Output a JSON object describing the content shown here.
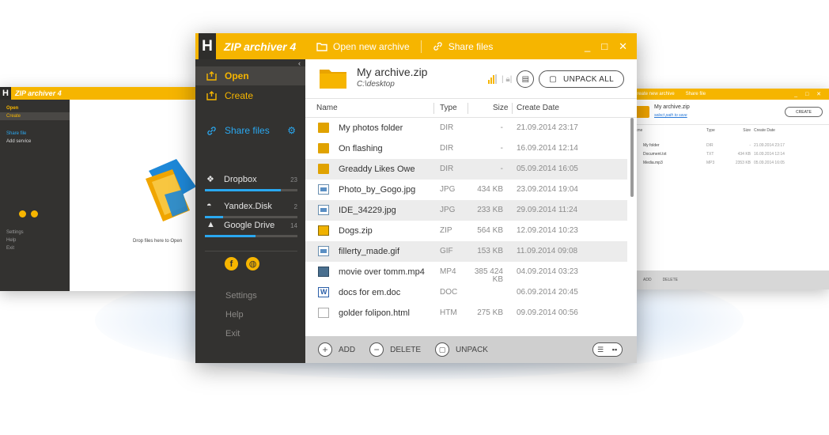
{
  "bg_left": {
    "title": "ZIP archiver 4",
    "menu": {
      "open": "Open",
      "create": "Create",
      "share": "Share file",
      "add_service": "Add service",
      "settings": "Settings",
      "help": "Help",
      "exit": "Exit"
    },
    "drop_text": "Drop files here to Open"
  },
  "bg_right": {
    "title_items": [
      "Create new archive",
      "Share file"
    ],
    "archive_name": "My archive.zip",
    "archive_link": "select path to save",
    "create_label": "CREATE",
    "columns": [
      "Name",
      "Type",
      "Size",
      "Create Date"
    ],
    "rows": [
      {
        "name": "My folder",
        "type": "DIR",
        "size": "-",
        "date": "21.09.2014  23:17"
      },
      {
        "name": "Document.txt",
        "type": "TXT",
        "size": "434 KB",
        "date": "16.09.2014  12:14"
      },
      {
        "name": "Media.mp3",
        "type": "MP3",
        "size": "2353 KB",
        "date": "05.09.2014  16:05"
      }
    ],
    "add_label": "ADD",
    "delete_label": "DELETE"
  },
  "app": {
    "logo_letter": "H",
    "title": "ZIP archiver 4",
    "toolbar": {
      "open_archive": "Open new archive",
      "share_files": "Share files"
    }
  },
  "sidebar": {
    "open": "Open",
    "create": "Create",
    "share": "Share files",
    "services": [
      {
        "name": "Dropbox",
        "count": "23",
        "fill": 0.82
      },
      {
        "name": "Yandex.Disk",
        "count": "2",
        "fill": 0.2
      },
      {
        "name": "Google Drive",
        "count": "14",
        "fill": 0.55
      }
    ],
    "settings": "Settings",
    "help": "Help",
    "exit": "Exit"
  },
  "archive": {
    "name": "My archive.zip",
    "path": "C:\\desktop",
    "unpack_all": "UNPACK ALL"
  },
  "columns": {
    "name": "Name",
    "type": "Type",
    "size": "Size",
    "date": "Create Date"
  },
  "files": [
    {
      "icon": "folder-icon",
      "name": "My photos folder",
      "type": "DIR",
      "size": "-",
      "date": "21.09.2014  23:17"
    },
    {
      "icon": "folder-icon",
      "name": "On flashing",
      "type": "DIR",
      "size": "-",
      "date": "16.09.2014  12:14"
    },
    {
      "icon": "folder-icon",
      "name": "Greaddy Likes Owe",
      "type": "DIR",
      "size": "-",
      "date": "05.09.2014  16:05"
    },
    {
      "icon": "image-file-icon",
      "name": "Photo_by_Gogo.jpg",
      "type": "JPG",
      "size": "434 KB",
      "date": "23.09.2014  19:04"
    },
    {
      "icon": "image-file-icon",
      "name": "IDE_34229.jpg",
      "type": "JPG",
      "size": "233 KB",
      "date": "29.09.2014  11:24"
    },
    {
      "icon": "zip-file-icon",
      "name": "Dogs.zip",
      "type": "ZIP",
      "size": "564 KB",
      "date": "12.09.2014  10:23"
    },
    {
      "icon": "image-file-icon",
      "name": "fillerty_made.gif",
      "type": "GIF",
      "size": "153 KB",
      "date": "11.09.2014  09:08"
    },
    {
      "icon": "video-file-icon",
      "name": "movie over tomm.mp4",
      "type": "MP4",
      "size": "385 424",
      "size2": "KB",
      "date": "04.09.2014  03:23"
    },
    {
      "icon": "word-file-icon",
      "name": "docs for em.doc",
      "type": "DOC",
      "size": "",
      "date": "06.09.2014  20:45"
    },
    {
      "icon": "html-file-icon",
      "name": "golder folipon.html",
      "type": "HTM",
      "size": "275 KB",
      "date": "09.09.2014  00:56"
    }
  ],
  "bottom": {
    "add": "ADD",
    "delete": "DELETE",
    "unpack": "UNPACK"
  },
  "colors": {
    "accent": "#f6b500",
    "sidebar": "#333230",
    "share_blue": "#2aa8f0"
  }
}
